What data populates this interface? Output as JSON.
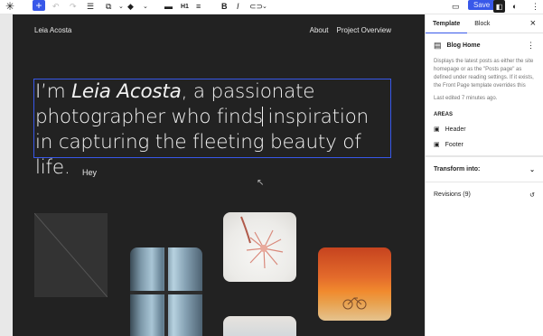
{
  "toolbar": {
    "icons": [
      "wordpress-logo-icon",
      "add-block-icon",
      "undo-icon",
      "redo-icon",
      "list-view-icon",
      "block-type-icon",
      "bookmark-icon",
      "chevron-down-icon",
      "align-icon",
      "heading-icon",
      "text-align-icon",
      "bold-icon",
      "italic-icon",
      "link-icon",
      "more-icon",
      "preview-icon",
      "sidebar-toggle-icon",
      "styles-icon",
      "options-icon"
    ],
    "heading_level": "H1",
    "bold": "B",
    "italic": "I",
    "save_label": "Save"
  },
  "canvas": {
    "site_title": "Leia Acosta",
    "nav": [
      "About",
      "Project Overview"
    ],
    "hero": {
      "before": "I’m ",
      "name": "Leia Acosta",
      "middle": ", a passionate photographer who finds",
      "after": " inspiration in capturing the fleeting beauty of life."
    },
    "hey": "Hey"
  },
  "sidebar": {
    "tabs": [
      "Template",
      "Block"
    ],
    "close": "×",
    "template_name": "Blog Home",
    "description": "Displays the latest posts as either the site homepage or as the \"Posts page\" as defined under reading settings. If it exists, the Front Page template overrides this",
    "last_edited": "Last edited 7 minutes ago.",
    "areas_label": "AREAS",
    "areas": [
      "Header",
      "Footer"
    ],
    "transform_label": "Transform into:",
    "revisions_label": "Revisions (9)"
  },
  "colors": {
    "accent": "#3858e9",
    "canvas_bg": "#222222"
  }
}
